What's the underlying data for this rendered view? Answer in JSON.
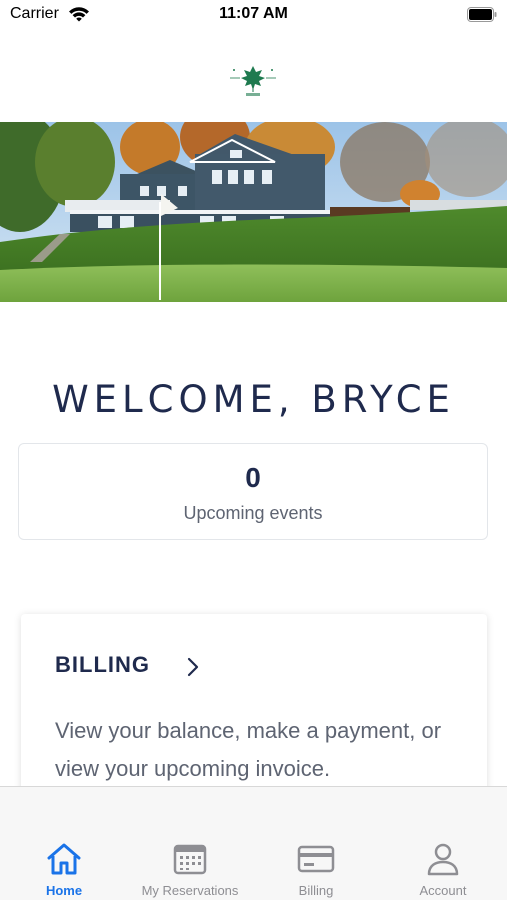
{
  "status_bar": {
    "carrier": "Carrier",
    "time": "11:07 AM"
  },
  "hero": {
    "image_name": "clubhouse-photo"
  },
  "welcome": {
    "text": "WELCOME, BRYCE"
  },
  "events": {
    "count": "0",
    "label": "Upcoming events"
  },
  "billing": {
    "title": "BILLING",
    "description": "View your balance, make a payment, or view your upcoming invoice."
  },
  "tab_bar": {
    "tabs": [
      {
        "label": "Home",
        "icon": "home-icon",
        "active": true
      },
      {
        "label": "My Reservations",
        "icon": "calendar-icon",
        "active": false
      },
      {
        "label": "Billing",
        "icon": "credit-card-icon",
        "active": false
      },
      {
        "label": "Account",
        "icon": "person-icon",
        "active": false
      }
    ]
  },
  "colors": {
    "navy": "#1f2a4d",
    "muted_text": "#5e6472",
    "active_tab": "#1a73e8",
    "inactive_tab": "#8e8e93",
    "logo_green": "#1e7a4f"
  }
}
